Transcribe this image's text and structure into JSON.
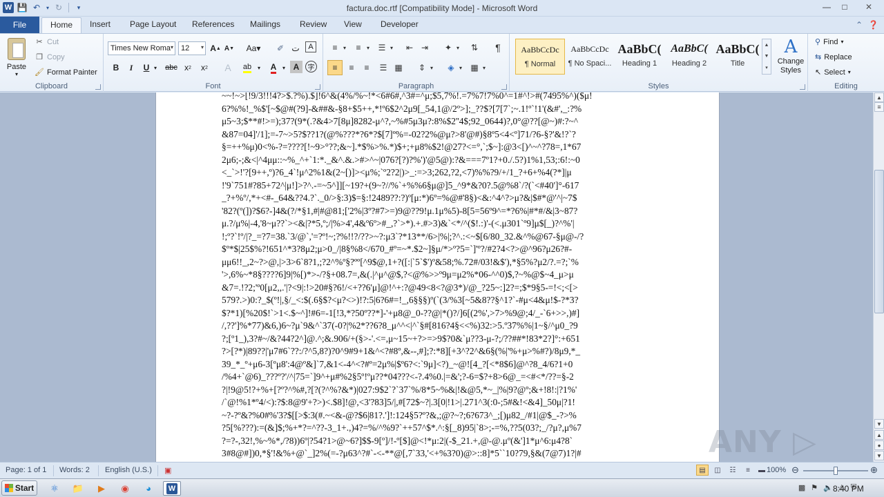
{
  "window": {
    "title": "factura.doc.rtf [Compatibility Mode] - Microsoft Word"
  },
  "tabs": {
    "file": "File",
    "items": [
      "Home",
      "Insert",
      "Page Layout",
      "References",
      "Mailings",
      "Review",
      "View",
      "Developer"
    ],
    "active": "Home"
  },
  "clipboard": {
    "paste": "Paste",
    "cut": "Cut",
    "copy": "Copy",
    "format_painter": "Format Painter",
    "label": "Clipboard"
  },
  "font": {
    "name": "Times New Roma",
    "size": "12",
    "label": "Font"
  },
  "paragraph": {
    "label": "Paragraph"
  },
  "styles": {
    "label": "Styles",
    "items": [
      {
        "preview": "AaBbCcDc",
        "name": "¶ Normal"
      },
      {
        "preview": "AaBbCcDc",
        "name": "¶ No Spaci..."
      },
      {
        "preview": "AaBbC(",
        "name": "Heading 1"
      },
      {
        "preview": "AaBbC(",
        "name": "Heading 2"
      },
      {
        "preview": "AaBbC(",
        "name": "Title"
      }
    ],
    "change_styles": "Change Styles"
  },
  "editing": {
    "find": "Find",
    "replace": "Replace",
    "select": "Select",
    "label": "Editing"
  },
  "document": {
    "lines": [
      "~~!~>[!9/3!!!4?>$.?%).$]!6^&(4%/%~!*<6#6#,^3#=^μ;$5,7%!.=7%7!7%0^=1#^!>#(7495%^)($μ!",
      "6?%%!_%$'[~$@#(?9]-&##&-§8+$5++,*!º6$2^2μ9[_54,1@/2º>];_??$?[7[7`;~.1!º`!1'(&#',_:?%",
      "μ5~3;$**#!>=);37?(9*(.?&4>7[8μ]8282-μ^?,~%#5μ3μ?:8%$2''4$;92_0644)?,0°@??[@~)#:?~^",
      "&87=04]'/1];=-7~>5?$??1?(@%???*?6*?$[7]º%=-02?2%@μ?>8'@#)§8º5<4<º]71/?6-§?'&!?`?",
      "§=++%μ)0<%-?=????[!~9>°??;&~].*$%>%.*)$+;+μ8%$2!@27?<=°,`;$~]:@3<[)^~^?78=,1*67",
      "2μ6;-;&<|^4μμ::~%_^+`1:*._&^.&.>#>^~|076?[?)?%')'@5@):?&===7º1?+0./.5?)1%1,53;:6!:~0",
      "<_`>!'?[9++,º)?6_4`!μ^2%1&(2~[)]><μ%;`º2?2|)>_:=>3;262,?2,<7)%%?9/+/1_?+6+%4(?*]|μ",
      "!'9`751#?85+72^|μ!]>?^.-=~5^]][~19?+(9~?//%`+%%6§μ@]5_^9*&?0?.5@%8`/?(`<#40']°-617",
      "_?+%º/,*+<#-_64&??4.?`._0/>§:3)$=§:!2489??:?)º[μ:*)6º=%@#'8§)<&:^4^?>μ?&|$#*@'^|~7$",
      "'82?(º(])?$6?-]4&(?/*§1,#|#@81;['2%|3º?#7>=)9@??9!μ.1μ%5)-8[5=56º9^=*?6%|#*#/&|3~87?",
      "μ.?/μ%|-4,'8~μ??`><&|?*5,º;/|%>4',4&º6º>#_,?`>*).+.#>3)&`<*/^($!.:)'-(<.μ301`º9]μ$[_)?^%'|",
      "!;º?`!º/|?_=?7=38.`3/@`,'=?º!~;?%!!?/??>~?:μ3`?*13**/6>|%|;?^.:<~$[6/80_32.&^%@67-§μ@-/?",
      "$º*$|25$%?!651^*3?8μ2;μ>0_/|8§%8</670_#º=~*.$2~]§μ/*>º?5=`]'º?/#2?4<?>@^96?μ26?#-",
      "μμ6!!_,2~?>@,|>3>6`8?1,;?2^%º§?ºº[^9$@,1+?([:|`5`$')º&58;%.72#/03!&$'),*§5%?μ2/?.=?;`%",
      "'>,6%~*8§????6]9|%[)*>-/?§+08.7=,&(.|^μ^@$,?<@%>>º9μ=μ2%*06-^^0)$,?~%@$~4_μ>μ",
      "&7=.!?2;'º0[μ2,,.'|?<9|:!>20#§?6!/<+??6'μ]@!^+:?@49<8<?@3*)/@_?25~:]2?=;$*9§5-=!<;<[>",
      "579?.>)0:?_$(º!|,§/_<:$(.6§$?<μ?<>)!?:5|6?6#=!_,6§§§)º(`(3/%3[~5&8??§^1?`-#μ<4&μ!$-?*3?",
      "$?*1)[%20$!`>1<.$~^]!#6=-1[!3,*?50º??*]-'+μ8@_0-??@|*()?/]6[(2%',>7>%9@;4/_-`6+>>,)#]",
      "/,??']%*77)&6,)6~?μ`9&^`37(-0?|%2*??6?8_μ^^<|^`§#[816?4§<<%)32:>5.º37%%|1~§/^μ0_?9",
      "?;[º1_),3?#~/&?44?2^]@.^;&.906/+(§>-'.<=,μ~15~+?>=>9$?0&`μ??3-μ-?;/??##*!83*2?]°:+651",
      "?>[?*)|89??|'μ7#6`??:/?^5,8?)?0^9#9+1&^<?#8º,&--,#];?:*8][+3^?2^&6§(%|'%+μ>%#?)/8μ9,*_",
      "39_*_º+μ6-3[ºμ8':4@º&]`7,&1<-4^<?#º=2μ%|$º6?<:`9μ]<?)_~@![4_?[<*8$6]@^?8_4/6?1+0",
      "/%4+`@6)_???º?'/^|75=`]9^+μ#%2§5º!ºμ??*04???<-?.4%0.|=&';?-6=$?+8>6@_=<#<*/??=§-2",
      "?|!9@5!?+%+[?º?^%#,?[?(?^%?&*)|027:9$2`?`37`%/8*5~%&|!&@5,*~_|%|9?@º;&+!8!:|?1%'",
      "/`@!%1*º4/<):?$:8@9'+?>)<.$8]!@,<3'?83]5/|,#[72$~?|.3[0|!1>|.271^3(:0-;5#&!<&4]_50μ|?1!",
      "~?-?º&?%0#%'3?$[[>$:3(#.~<&-@?$6|81?.']!:124§5?º?&,;@?~?;6?673^_;[)μ82_/#1|@$_-?>%",
      "?5[%???):=(&]$;%+*?=^??-3_1+.,)4?=%/^%9?`++57^$*.^:§[_8)95|`8>;-=%,??5(03?;_/?μ?,μ%7",
      "?=?-,32!,%~%*,/?8))6º|?54?1>@~6?]$$-9[º]/!-º[$]@<!*μ:2|(-$_21.+,@-@.μº(&']1*μ^6:μ4?8`",
      "3#8@#])0,*§'!&%+@`_]2%(=-?μ63^?#`-<-**@[,7`33,'<+%3?0)@>::8]*5``10?79,§&(7@7)1?|#"
    ]
  },
  "status": {
    "page": "Page: 1 of 1",
    "words": "Words: 2",
    "language": "English (U.S.)",
    "zoom": "100%",
    "zoom_level_percent": 100
  },
  "watermark": "ANY ▷ RUN",
  "taskbar": {
    "start": "Start",
    "clock": "8:40 PM"
  }
}
